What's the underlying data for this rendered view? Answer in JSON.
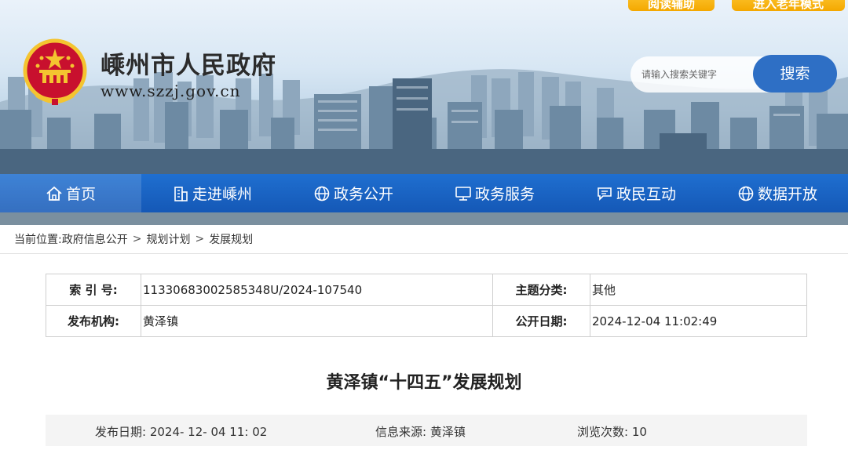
{
  "header": {
    "top_buttons": [
      "阅读辅助",
      "进入老年模式"
    ],
    "site_title": "嵊州市人民政府",
    "site_url": "www.szzj.gov.cn",
    "search_placeholder": "请输入搜索关键字",
    "search_button": "搜索"
  },
  "nav": {
    "items": [
      {
        "label": "首页",
        "icon": "home-icon"
      },
      {
        "label": "走进嵊州",
        "icon": "building-icon"
      },
      {
        "label": "政务公开",
        "icon": "globe-icon"
      },
      {
        "label": "政务服务",
        "icon": "monitor-icon"
      },
      {
        "label": "政民互动",
        "icon": "chat-icon"
      },
      {
        "label": "数据开放",
        "icon": "globe-icon"
      }
    ]
  },
  "breadcrumb": {
    "prefix": "当前位置:",
    "items": [
      "政府信息公开",
      "规划计划",
      "发展规划"
    ],
    "separator": ">"
  },
  "meta": {
    "index_label": "索 引 号:",
    "index_value": "11330683002585348U/2024-107540",
    "topic_label": "主题分类:",
    "topic_value": "其他",
    "org_label": "发布机构:",
    "org_value": "黄泽镇",
    "date_label": "公开日期:",
    "date_value": "2024-12-04 11:02:49"
  },
  "document": {
    "title": "黄泽镇“十四五”发展规划",
    "publish_date": "发布日期:   2024- 12- 04 11: 02",
    "source": "信息来源:   黄泽镇",
    "views": "浏览次数:   10"
  },
  "colors": {
    "nav_blue": "#1a63c4",
    "search_button": "#2e6fc5",
    "top_button": "#f4a800"
  }
}
